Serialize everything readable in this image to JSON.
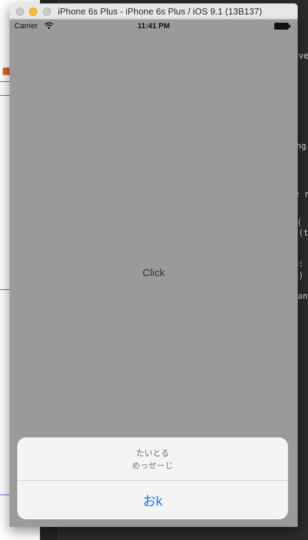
{
  "window": {
    "title": "iPhone 6s Plus - iPhone 6s Plus / iOS 9.1 (13B137)"
  },
  "status_bar": {
    "carrier": "Carrier",
    "time": "11:41 PM"
  },
  "main": {
    "click_label": "Click"
  },
  "action_sheet": {
    "title": "たいとる",
    "message": "めっせーじ",
    "ok_label": "おk"
  },
  "background_code": {
    "lines": [
      "rve",
      "ng",
      "e r",
      "(",
      "f(t",
      "e:",
      "n)",
      "an"
    ]
  },
  "colors": {
    "screen_background": "#9a9a9a",
    "action_sheet_background": "#f4f4f4",
    "action_button_text": "#0a79f5",
    "window_minimize_light": "#fbbd2e"
  },
  "icons": [
    "wifi-icon",
    "battery-icon"
  ]
}
